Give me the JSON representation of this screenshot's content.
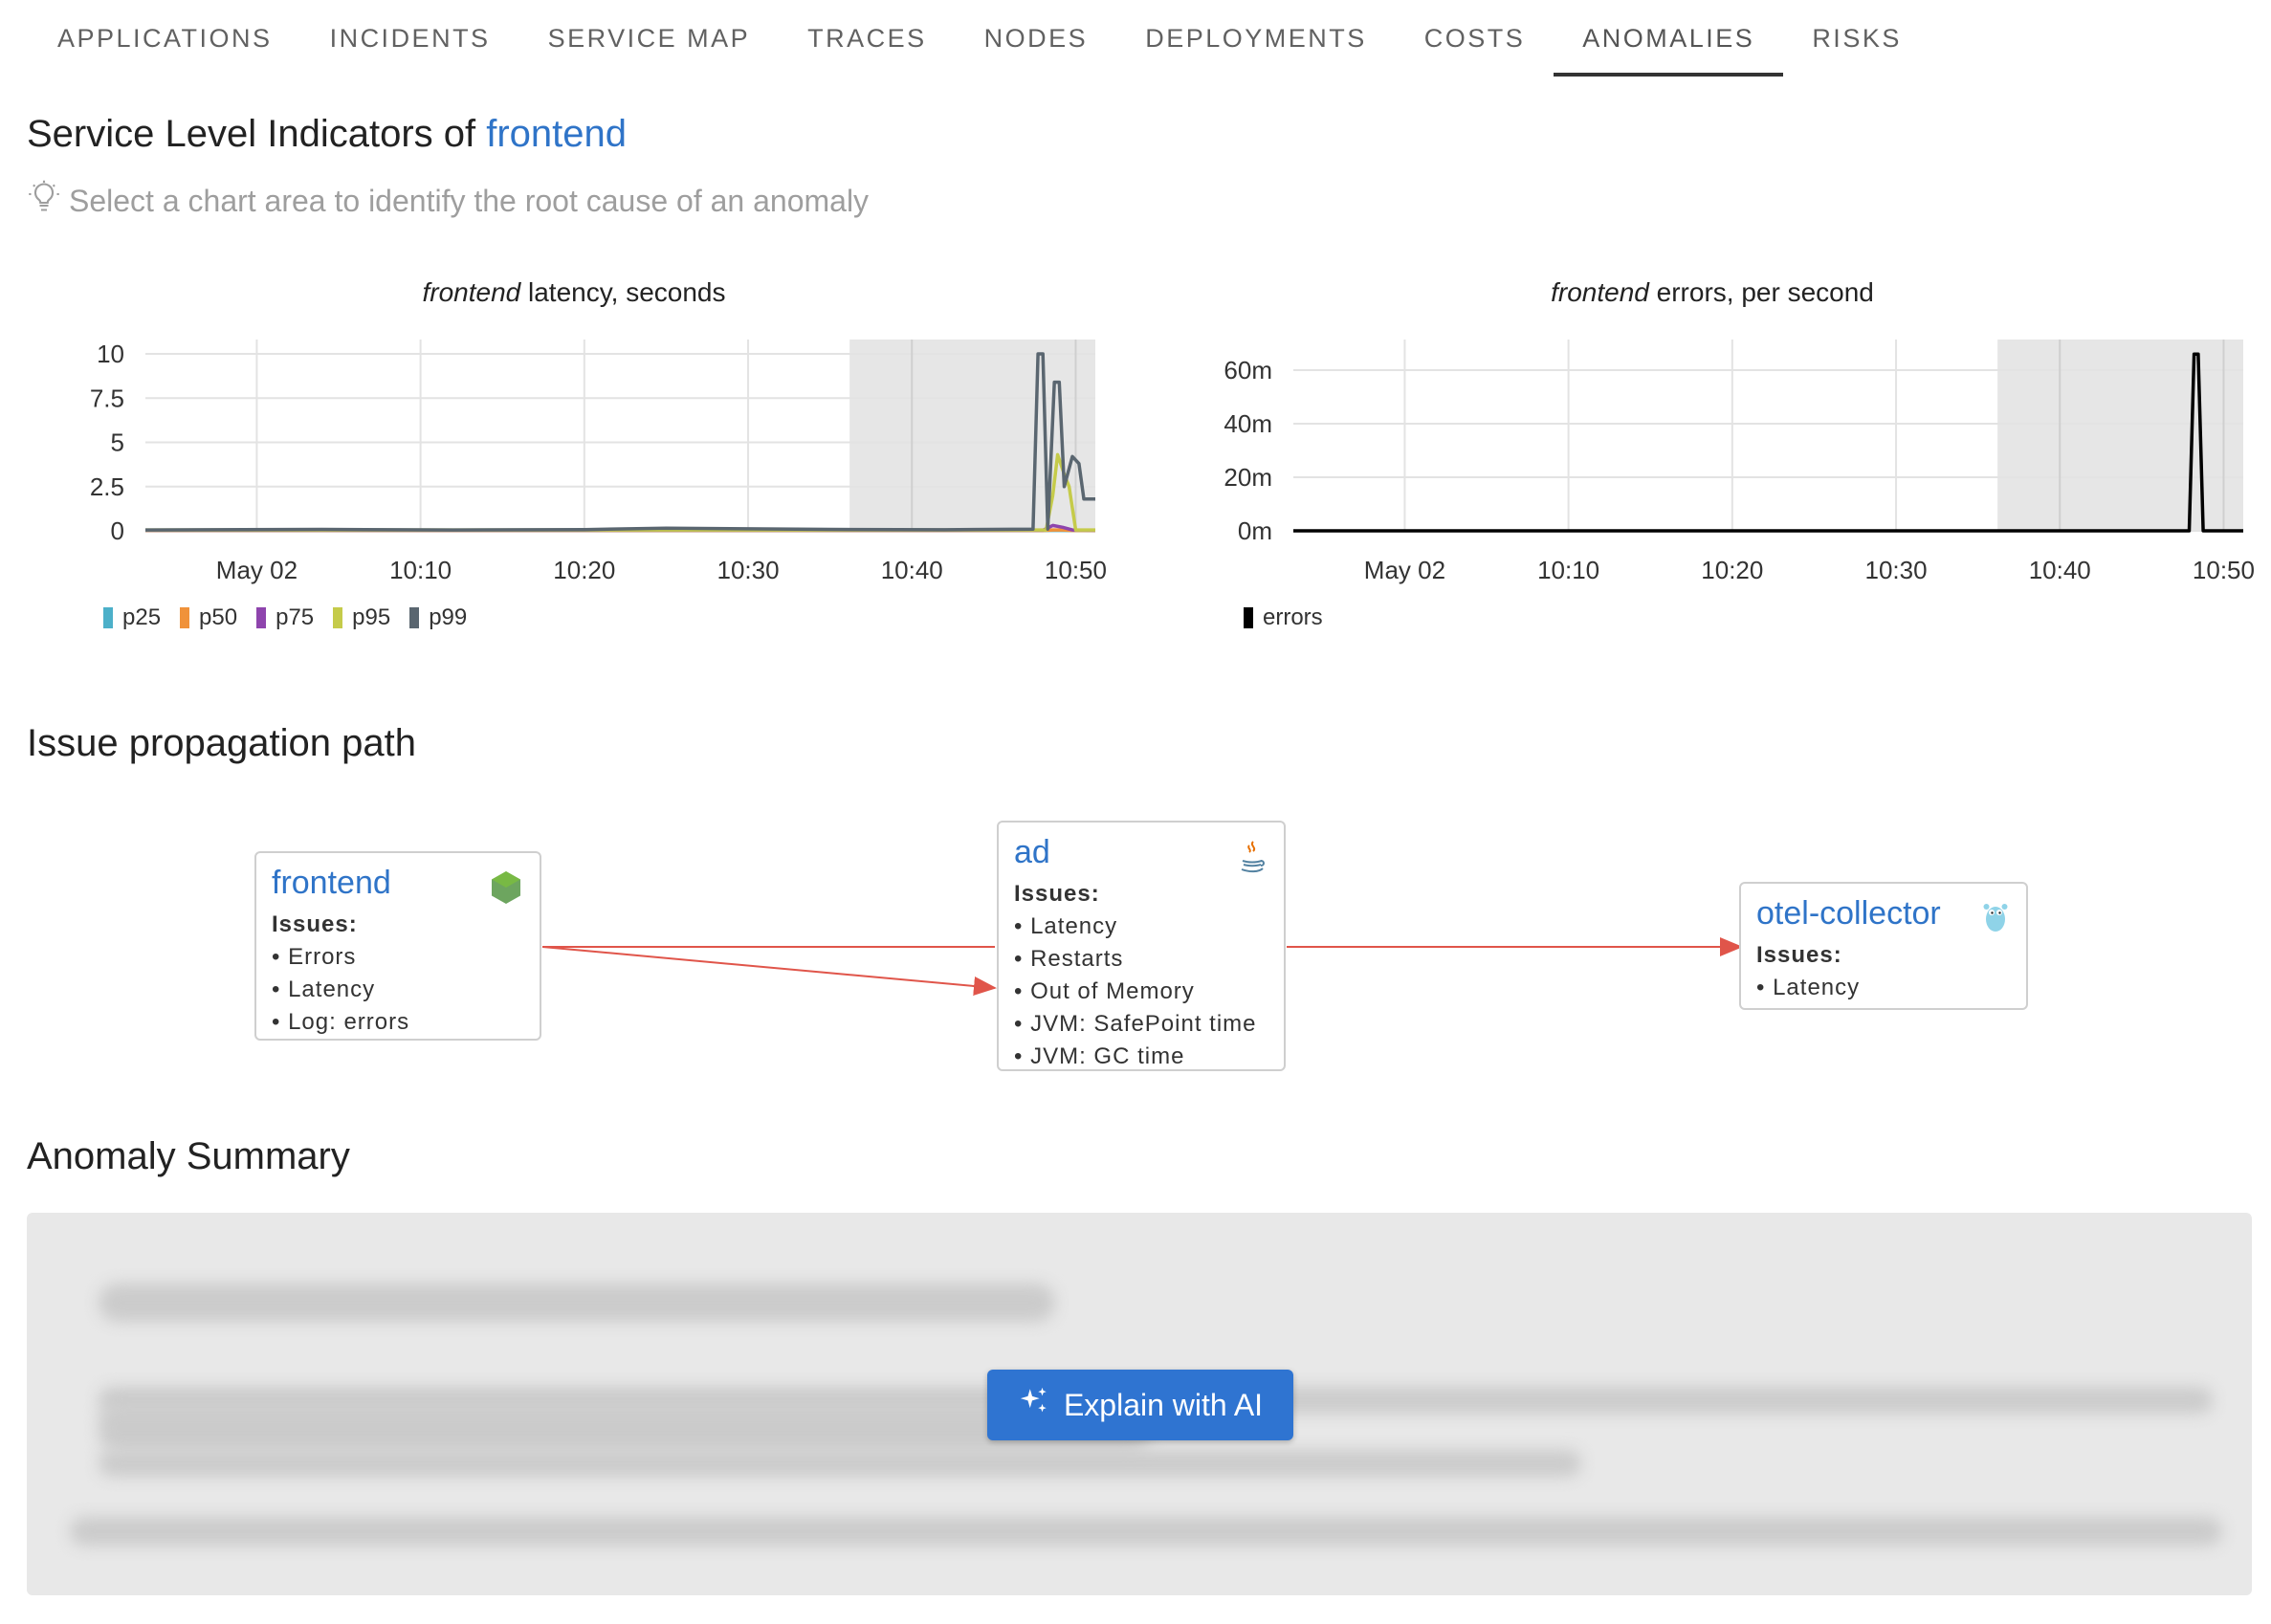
{
  "tabs": [
    {
      "label": "APPLICATIONS"
    },
    {
      "label": "INCIDENTS"
    },
    {
      "label": "SERVICE MAP"
    },
    {
      "label": "TRACES"
    },
    {
      "label": "NODES"
    },
    {
      "label": "DEPLOYMENTS"
    },
    {
      "label": "COSTS"
    },
    {
      "label": "ANOMALIES",
      "active": true
    },
    {
      "label": "RISKS"
    }
  ],
  "sli": {
    "title_prefix": "Service Level Indicators of",
    "service": "frontend",
    "hint": "Select a chart area to identify the root cause of an anomaly"
  },
  "charts": {
    "latency": {
      "title_italic": "frontend",
      "title_rest": "latency, seconds"
    },
    "errors": {
      "title_italic": "frontend",
      "title_rest": "errors, per second"
    }
  },
  "chart_data": [
    {
      "type": "line",
      "title": "frontend latency, seconds",
      "x_ticks": [
        "May 02",
        "10:10",
        "10:20",
        "10:30",
        "10:40",
        "10:50"
      ],
      "x_tick_minutes": [
        0,
        10,
        20,
        30,
        40,
        50
      ],
      "x_range_minutes": [
        -6.8,
        51.2
      ],
      "y_ticks": [
        "10",
        "7.5",
        "5",
        "2.5",
        "0"
      ],
      "ylim": [
        0,
        10
      ],
      "selection_minutes": [
        36.2,
        51.2
      ],
      "grid": true,
      "legend_placement": "bottom-left",
      "series": [
        {
          "name": "p25",
          "color": "#4cb0c9",
          "points": [
            [
              -6.8,
              0.01
            ],
            [
              47.8,
              0.01
            ],
            [
              48.4,
              0.02
            ],
            [
              49,
              0.02
            ],
            [
              50,
              0.01
            ],
            [
              51.2,
              0.01
            ]
          ]
        },
        {
          "name": "p50",
          "color": "#f0923a",
          "points": [
            [
              -6.8,
              0.02
            ],
            [
              48,
              0.02
            ],
            [
              48.6,
              0.05
            ],
            [
              49.2,
              0.05
            ],
            [
              49.8,
              0.02
            ],
            [
              51.2,
              0.02
            ]
          ]
        },
        {
          "name": "p75",
          "color": "#8e44ad",
          "points": [
            [
              -6.8,
              0.03
            ],
            [
              48,
              0.03
            ],
            [
              48.6,
              0.3
            ],
            [
              49.2,
              0.2
            ],
            [
              49.8,
              0.05
            ],
            [
              51.2,
              0.03
            ]
          ]
        },
        {
          "name": "p95",
          "color": "#c5cb4a",
          "points": [
            [
              -6.8,
              0.05
            ],
            [
              48.2,
              0.05
            ],
            [
              48.6,
              2.0
            ],
            [
              48.9,
              4.3
            ],
            [
              49.3,
              3.2
            ],
            [
              49.6,
              2.5
            ],
            [
              50,
              0.05
            ],
            [
              51.2,
              0.05
            ]
          ]
        },
        {
          "name": "p99",
          "color": "#5a6670",
          "points": [
            [
              -6.8,
              0.05
            ],
            [
              4,
              0.08
            ],
            [
              12,
              0.05
            ],
            [
              20,
              0.07
            ],
            [
              25,
              0.15
            ],
            [
              35,
              0.08
            ],
            [
              42,
              0.06
            ],
            [
              47.4,
              0.1
            ],
            [
              47.7,
              10
            ],
            [
              48.0,
              10
            ],
            [
              48.3,
              0.1
            ],
            [
              48.7,
              8.4
            ],
            [
              49.0,
              8.4
            ],
            [
              49.3,
              2.5
            ],
            [
              49.8,
              4.2
            ],
            [
              50.2,
              3.8
            ],
            [
              50.5,
              1.8
            ],
            [
              51.2,
              1.8
            ]
          ]
        }
      ]
    },
    {
      "type": "line",
      "title": "frontend errors, per second",
      "x_ticks": [
        "May 02",
        "10:10",
        "10:20",
        "10:30",
        "10:40",
        "10:50"
      ],
      "x_tick_minutes": [
        0,
        10,
        20,
        30,
        40,
        50
      ],
      "x_range_minutes": [
        -6.8,
        51.2
      ],
      "y_ticks": [
        "60m",
        "40m",
        "20m",
        "0m"
      ],
      "ylim": [
        0,
        0.06
      ],
      "selection_minutes": [
        36.2,
        51.2
      ],
      "grid": true,
      "legend_placement": "bottom-left",
      "series": [
        {
          "name": "errors",
          "color": "#000000",
          "points": [
            [
              -6.8,
              0
            ],
            [
              47.9,
              0
            ],
            [
              48.2,
              0.066
            ],
            [
              48.45,
              0.066
            ],
            [
              48.75,
              0
            ],
            [
              51.2,
              0
            ]
          ]
        }
      ]
    }
  ],
  "propagation": {
    "title": "Issue propagation path",
    "issues_label": "Issues:",
    "nodes": [
      {
        "name": "frontend",
        "icon": "nodejs-icon",
        "issues": [
          "Errors",
          "Latency",
          "Log: errors"
        ]
      },
      {
        "name": "ad",
        "icon": "java-icon",
        "issues": [
          "Latency",
          "Restarts",
          "Out of Memory",
          "JVM: SafePoint time",
          "JVM: GC time"
        ]
      },
      {
        "name": "otel-collector",
        "icon": "go-gopher-icon",
        "issues": [
          "Latency"
        ]
      }
    ],
    "edge_color": "#e0554a"
  },
  "summary": {
    "title": "Anomaly Summary",
    "button_label": "Explain with AI",
    "button_color": "#2f74d1"
  },
  "colors": {
    "link": "#2f74c8",
    "selection": "#e6e6e6"
  }
}
